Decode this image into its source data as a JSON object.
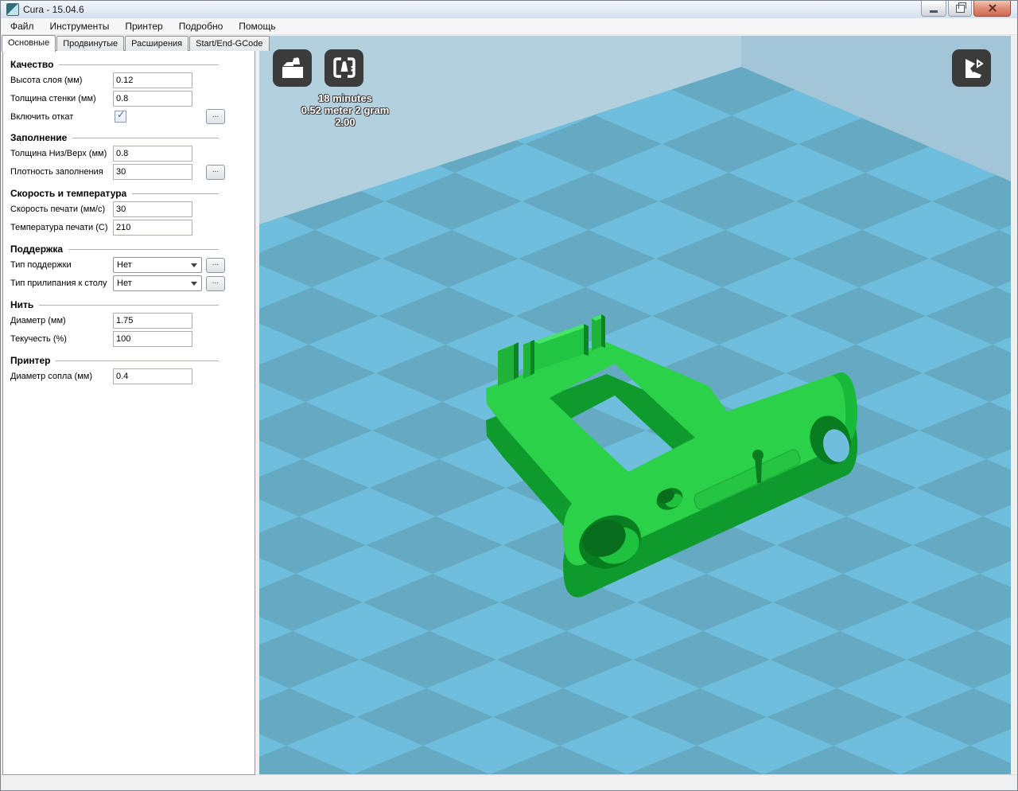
{
  "window": {
    "title": "Cura - 15.04.6"
  },
  "menu": {
    "items": [
      "Файл",
      "Инструменты",
      "Принтер",
      "Подробно",
      "Помощь"
    ]
  },
  "tabs": [
    {
      "label": "Основные",
      "active": true
    },
    {
      "label": "Продвинутые",
      "active": false
    },
    {
      "label": "Расширения",
      "active": false
    },
    {
      "label": "Start/End-GCode",
      "active": false
    }
  ],
  "panel": {
    "more_label": "...",
    "sections": [
      {
        "title": "Качество",
        "rows": [
          {
            "key": "layer-height",
            "label": "Высота слоя (мм)",
            "type": "input",
            "value": "0.12"
          },
          {
            "key": "wall-thickness",
            "label": "Толщина стенки (мм)",
            "type": "input",
            "value": "0.8"
          },
          {
            "key": "enable-retraction",
            "label": "Включить откат",
            "type": "checkbox",
            "checked": true,
            "more": true
          }
        ]
      },
      {
        "title": "Заполнение",
        "rows": [
          {
            "key": "bottom-top-thickness",
            "label": "Толщина Низ/Верх (мм)",
            "type": "input",
            "value": "0.8"
          },
          {
            "key": "fill-density",
            "label": "Плотность заполнения",
            "type": "input",
            "value": "30",
            "more": true
          }
        ]
      },
      {
        "title": "Скорость и температура",
        "rows": [
          {
            "key": "print-speed",
            "label": "Скорость печати (мм/с)",
            "type": "input",
            "value": "30"
          },
          {
            "key": "print-temperature",
            "label": "Температура печати (C)",
            "type": "input",
            "value": "210"
          }
        ]
      },
      {
        "title": "Поддержка",
        "rows": [
          {
            "key": "support-type",
            "label": "Тип поддержки",
            "type": "select",
            "value": "Нет",
            "more": true
          },
          {
            "key": "platform-adhesion",
            "label": "Тип прилипания к столу",
            "type": "select",
            "value": "Нет",
            "more": true
          }
        ]
      },
      {
        "title": "Нить",
        "rows": [
          {
            "key": "filament-diameter",
            "label": "Диаметр (мм)",
            "type": "input",
            "value": "1.75"
          },
          {
            "key": "filament-flow",
            "label": "Текучесть (%)",
            "type": "input",
            "value": "100"
          }
        ]
      },
      {
        "title": "Принтер",
        "rows": [
          {
            "key": "nozzle-size",
            "label": "Диаметр сопла (мм)",
            "type": "input",
            "value": "0.4"
          }
        ]
      }
    ]
  },
  "viewport": {
    "stats": [
      "18 minutes",
      "0.52 meter 2 gram",
      "2.00"
    ],
    "colors": {
      "model_green": "#2bd249",
      "model_dark_green": "#0e9a2c",
      "hole_dark": "#097e21",
      "floor_light": "#6fbedd",
      "floor_dark": "#65aac2",
      "wall_back": "#b2d0de",
      "wall_right": "#a2c6d7",
      "button_bg": "#3b3b3b"
    }
  }
}
